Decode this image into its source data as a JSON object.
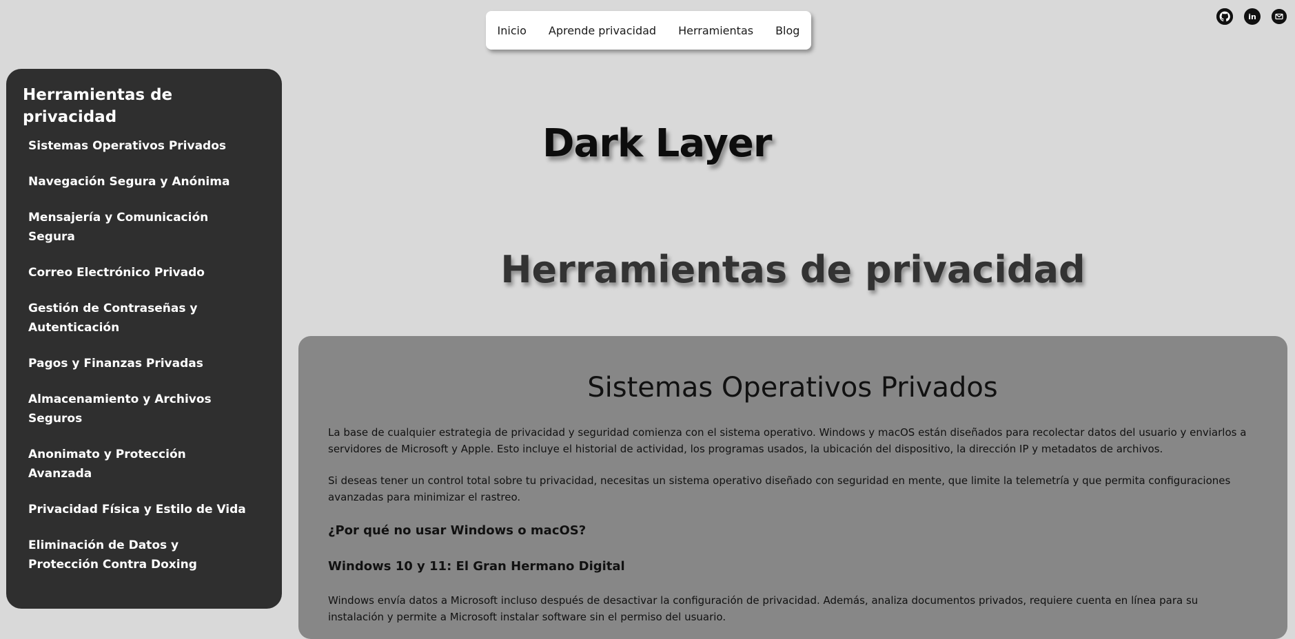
{
  "nav": {
    "items": [
      {
        "label": "Inicio"
      },
      {
        "label": "Aprende privacidad"
      },
      {
        "label": "Herramientas"
      },
      {
        "label": "Blog"
      }
    ]
  },
  "social": {
    "icons": [
      "github-icon",
      "linkedin-icon",
      "email-icon"
    ],
    "linkedin_text": "in"
  },
  "sidebar": {
    "title": "Herramientas de privacidad",
    "items": [
      {
        "label": "Sistemas Operativos Privados"
      },
      {
        "label": "Navegación Segura y Anónima"
      },
      {
        "label": "Mensajería y Comunicación Segura"
      },
      {
        "label": "Correo Electrónico Privado"
      },
      {
        "label": "Gestión de Contraseñas y Autenticación"
      },
      {
        "label": "Pagos y Finanzas Privadas"
      },
      {
        "label": "Almacenamiento y Archivos Seguros"
      },
      {
        "label": "Anonimato y Protección Avanzada"
      },
      {
        "label": "Privacidad Física y Estilo de Vida"
      },
      {
        "label": "Eliminación de Datos y Protección Contra Doxing"
      }
    ]
  },
  "brand": "Dark Layer",
  "page_heading": "Herramientas de privacidad",
  "content": {
    "title": "Sistemas Operativos Privados",
    "p1": "La base de cualquier estrategia de privacidad y seguridad comienza con el sistema operativo. Windows y macOS están diseñados para recolectar datos del usuario y enviarlos a servidores de Microsoft y Apple. Esto incluye el historial de actividad, los programas usados, la ubicación del dispositivo, la dirección IP y metadatos de archivos.",
    "p2": "Si deseas tener un control total sobre tu privacidad, necesitas un sistema operativo diseñado con seguridad en mente, que limite la telemetría y que permita configuraciones avanzadas para minimizar el rastreo.",
    "h_why": "¿Por qué no usar Windows o macOS?",
    "h_win": "Windows 10 y 11: El Gran Hermano Digital",
    "p3": "Windows envía datos a Microsoft incluso después de desactivar la configuración de privacidad. Además, analiza documentos privados, requiere cuenta en línea para su instalación y permite a Microsoft instalar software sin el permiso del usuario."
  },
  "colors": {
    "page_bg": "#d9d9d9",
    "sidebar_bg": "#2f2f2f",
    "card_bg": "#878787",
    "nav_bg": "#ffffff"
  }
}
